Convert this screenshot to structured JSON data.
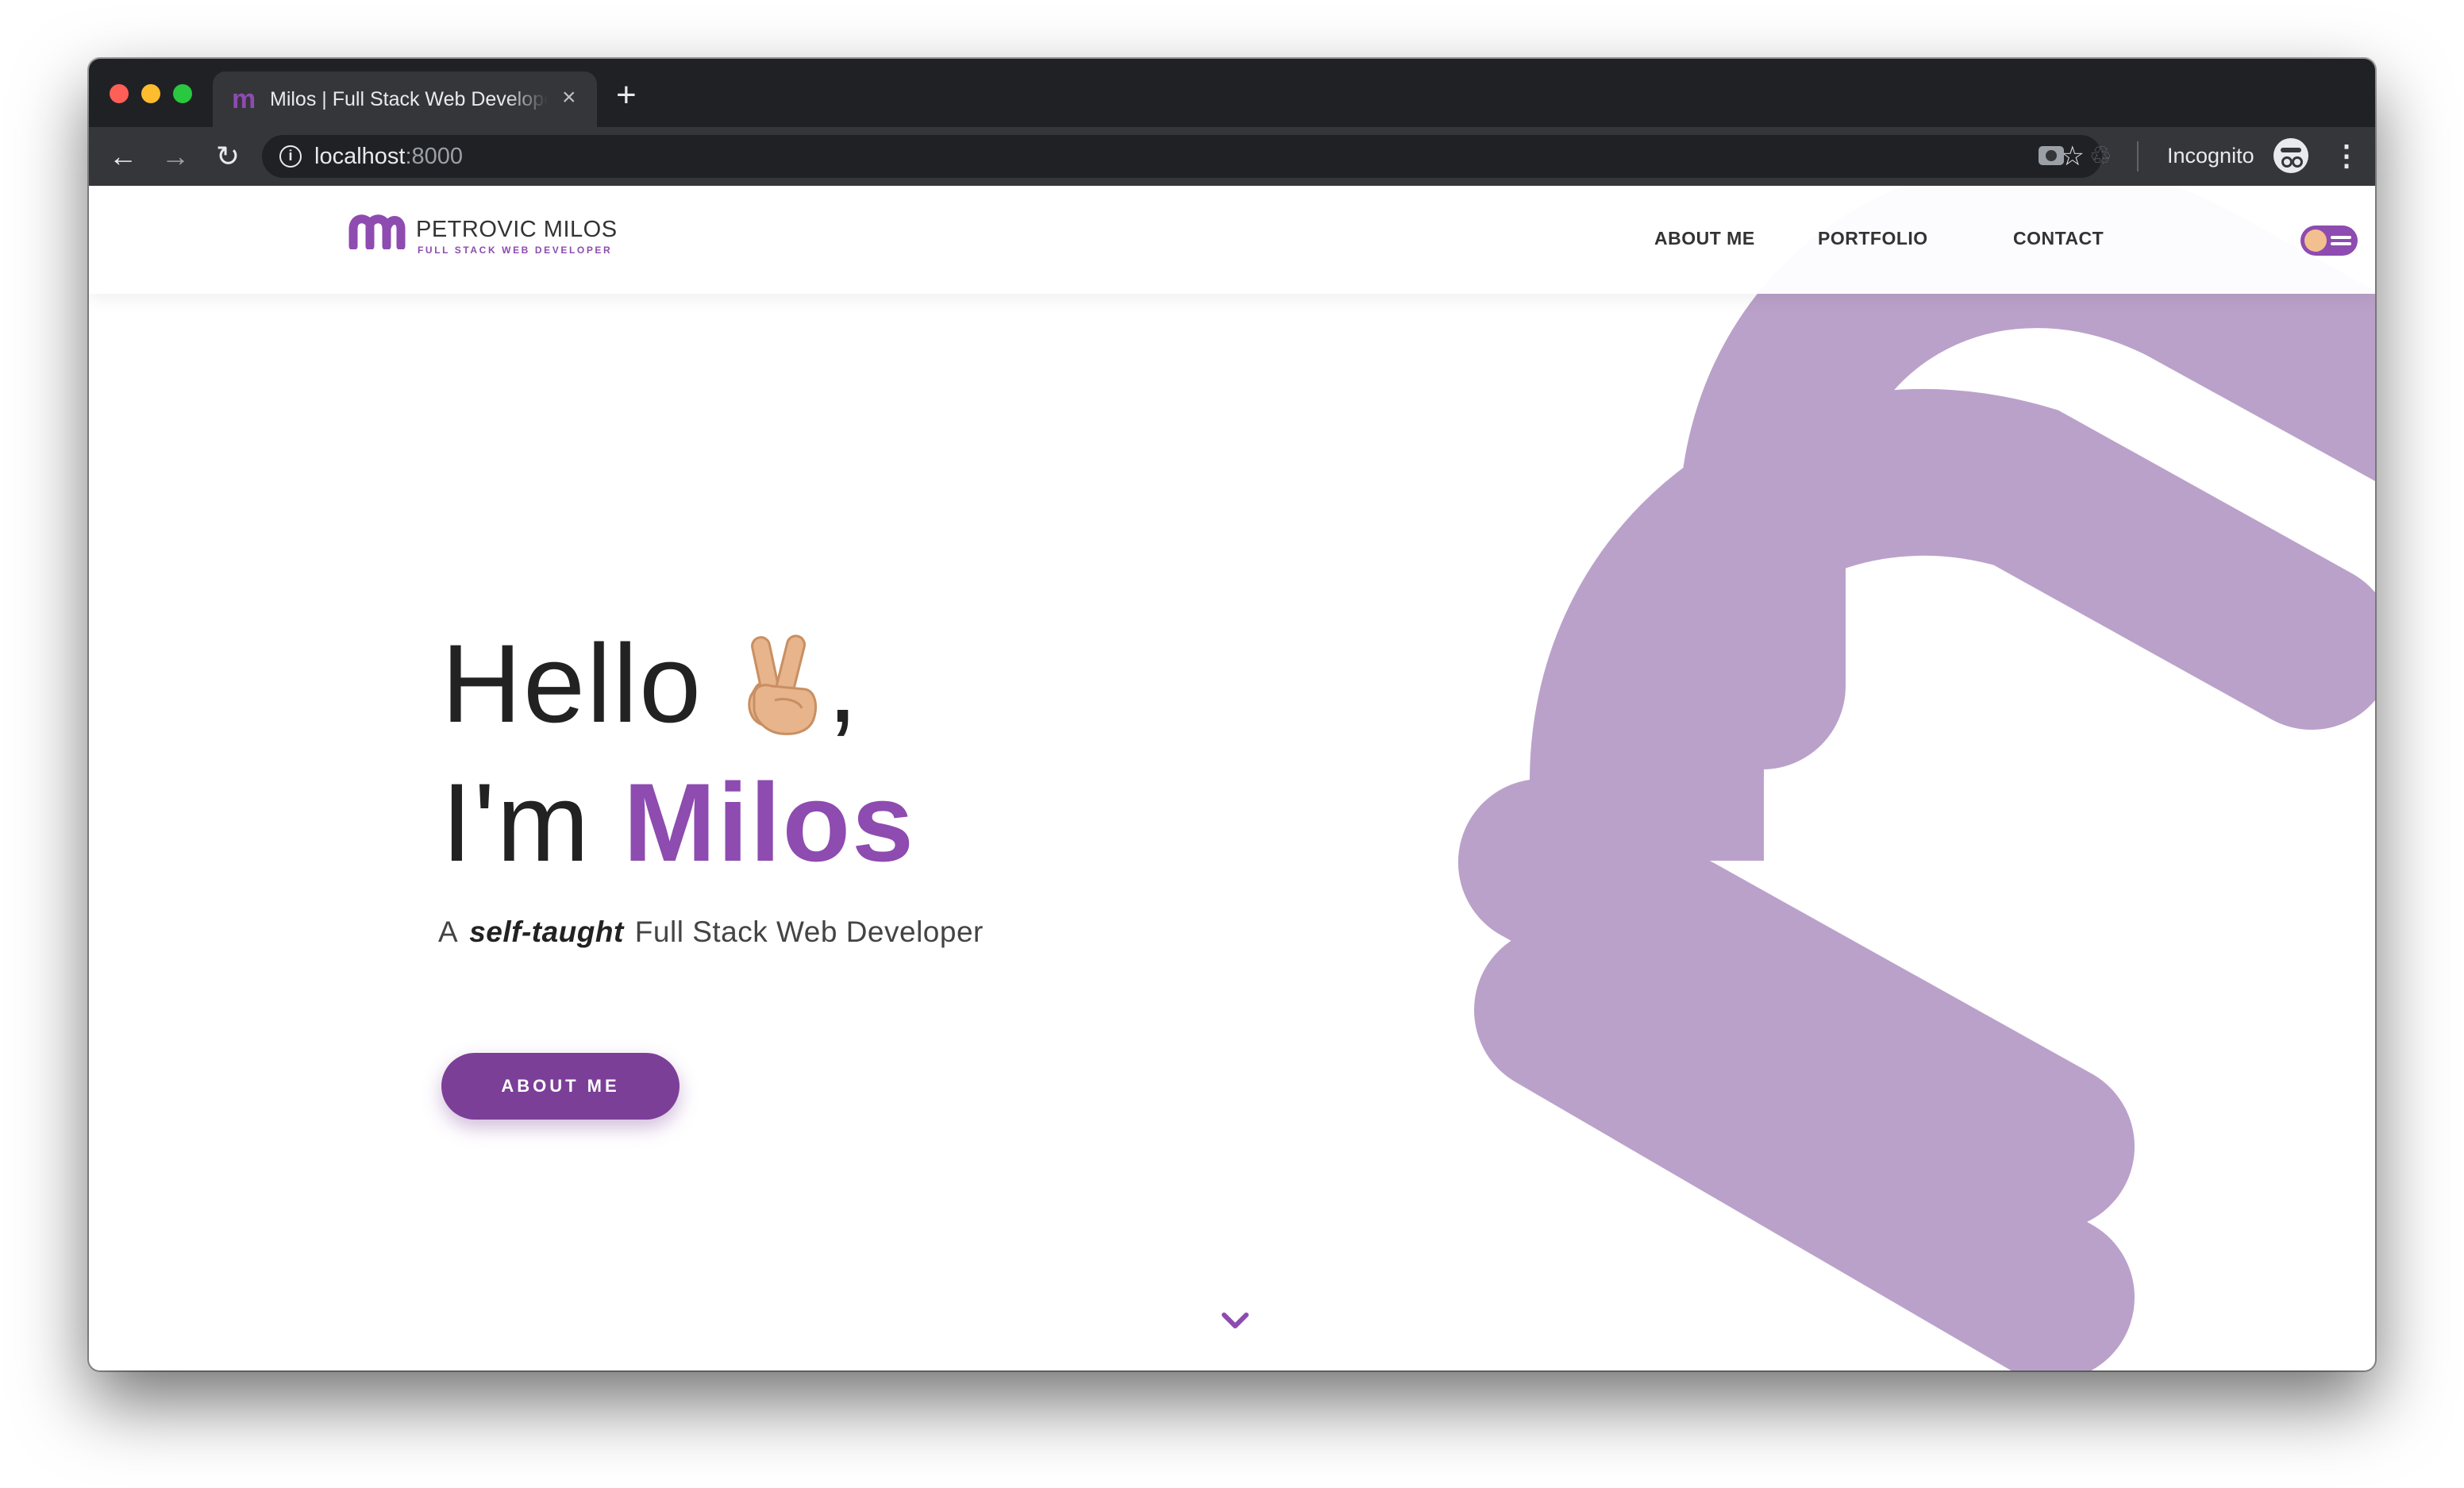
{
  "browser": {
    "tab_title": "Milos | Full Stack Web Developer",
    "tab_favicon": "m",
    "tab_close": "×",
    "new_tab": "+",
    "url_host": "localhost",
    "url_port": ":8000",
    "incognito_label": "Incognito",
    "icons": [
      "back-arrow-icon",
      "forward-arrow-icon",
      "reload-icon",
      "info-icon",
      "star-icon",
      "camera-icon",
      "extension-icon",
      "incognito-icon",
      "kebab-menu-icon"
    ]
  },
  "site": {
    "logo_name": "PETROVIC MILOS",
    "logo_tagline": "FULL STACK WEB DEVELOPER",
    "nav": [
      "ABOUT ME",
      "PORTFOLIO",
      "CONTACT"
    ]
  },
  "hero": {
    "hello": "Hello",
    "comma": ",",
    "im": "I'm",
    "name": "Milos",
    "subtitle_prefix": "A",
    "subtitle_emphasis": "self-taught",
    "subtitle_suffix": "Full Stack Web Developer",
    "cta_label": "ABOUT ME"
  },
  "colors": {
    "accent": "#8e4bb0",
    "accent_dark": "#7b3f98",
    "background_m": "#baa1ca",
    "tab_bar": "#202124",
    "toolbar": "#35363a"
  }
}
